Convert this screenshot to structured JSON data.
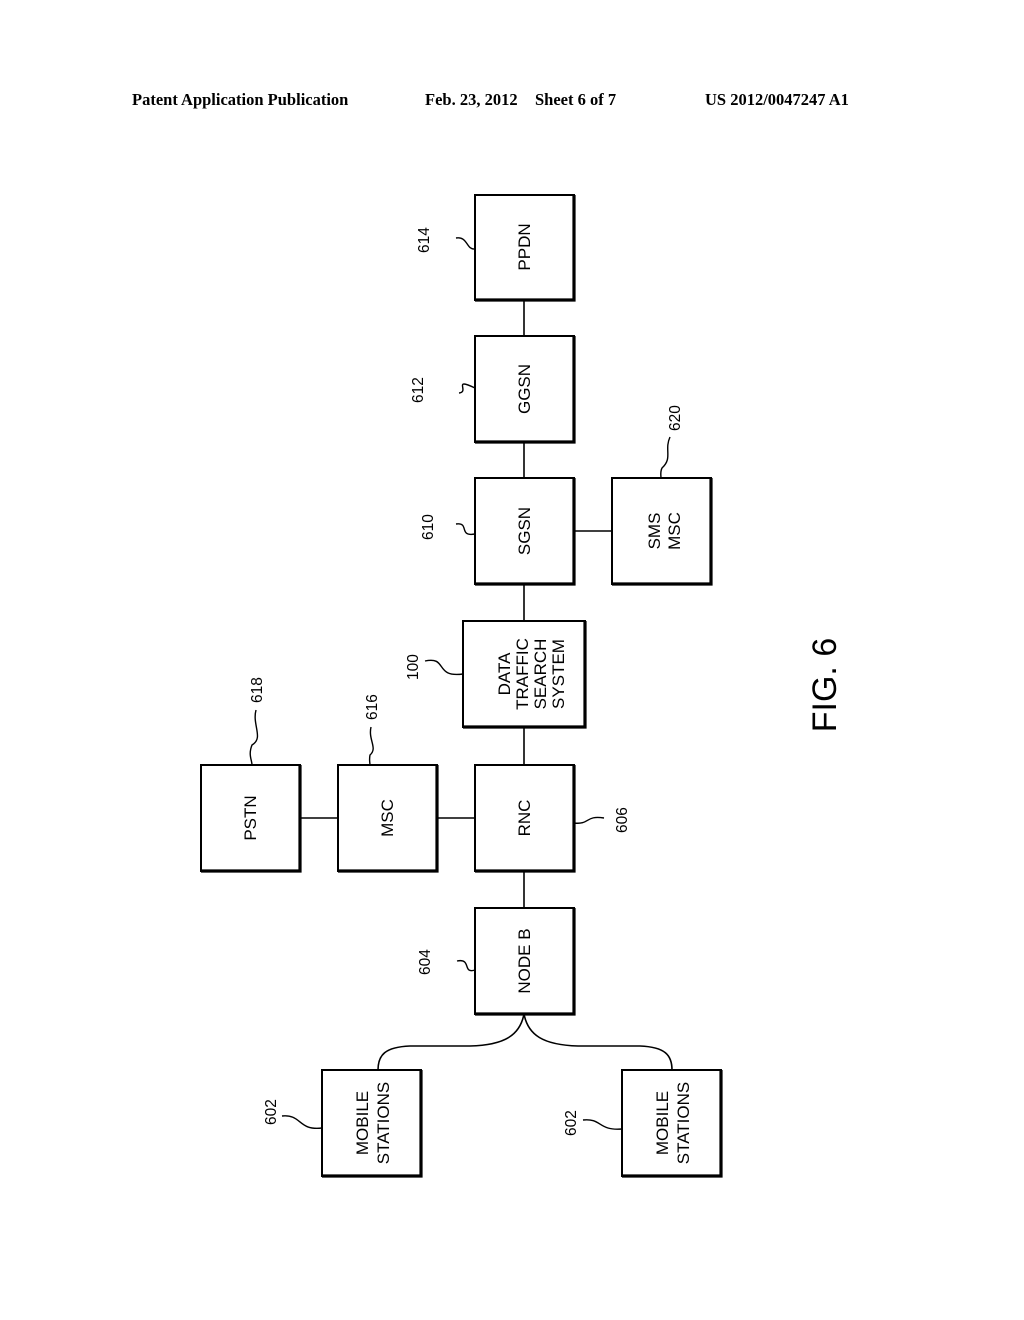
{
  "header": {
    "publication": "Patent Application Publication",
    "date": "Feb. 23, 2012",
    "sheet": "Sheet 6 of 7",
    "number": "US 2012/0047247 A1"
  },
  "figure": {
    "caption": "FIG. 6",
    "nodes": {
      "ppdn": {
        "lines": [
          "PPDN"
        ],
        "ref": "614"
      },
      "ggsn": {
        "lines": [
          "GGSN"
        ],
        "ref": "612"
      },
      "sgsn": {
        "lines": [
          "SGSN"
        ],
        "ref": "610"
      },
      "sms_msc": {
        "lines": [
          "SMS",
          "MSC"
        ],
        "ref": "620"
      },
      "dtss": {
        "lines": [
          "DATA",
          "TRAFFIC",
          "SEARCH",
          "SYSTEM"
        ],
        "ref": "100"
      },
      "rnc": {
        "lines": [
          "RNC"
        ],
        "ref": "606"
      },
      "msc": {
        "lines": [
          "MSC"
        ],
        "ref": "616"
      },
      "pstn": {
        "lines": [
          "PSTN"
        ],
        "ref": "618"
      },
      "node_b": {
        "lines": [
          "NODE B"
        ],
        "ref": "604"
      },
      "mobile_1": {
        "lines": [
          "MOBILE",
          "STATIONS"
        ],
        "ref": "602"
      },
      "mobile_2": {
        "lines": [
          "MOBILE",
          "STATIONS"
        ],
        "ref": "602"
      }
    },
    "connections": [
      [
        "ppdn",
        "ggsn"
      ],
      [
        "ggsn",
        "sgsn"
      ],
      [
        "sgsn",
        "sms_msc"
      ],
      [
        "sgsn",
        "dtss"
      ],
      [
        "dtss",
        "rnc"
      ],
      [
        "rnc",
        "msc"
      ],
      [
        "msc",
        "pstn"
      ],
      [
        "rnc",
        "node_b"
      ],
      [
        "node_b",
        "mobile_1"
      ],
      [
        "node_b",
        "mobile_2"
      ]
    ]
  }
}
